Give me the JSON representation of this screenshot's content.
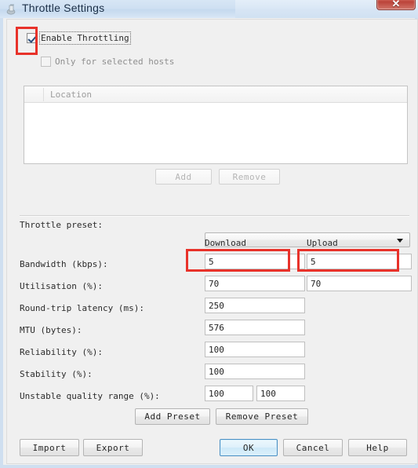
{
  "window": {
    "title": "Throttle Settings",
    "icon": "app-icon",
    "close_label": "✕"
  },
  "options": {
    "enable_throttling": {
      "label": "Enable Throttling",
      "checked": true,
      "focused": true
    },
    "only_selected_hosts": {
      "label": "Only for selected hosts",
      "checked": false,
      "disabled": true
    }
  },
  "hosts_list": {
    "columns": [
      "Location"
    ],
    "rows": [],
    "add_button": "Add",
    "remove_button": "Remove"
  },
  "preset": {
    "label": "Throttle preset:",
    "value": "",
    "placeholder": ""
  },
  "column_headers": {
    "download": "Download",
    "upload": "Upload"
  },
  "fields": [
    {
      "label": "Bandwidth (kbps):",
      "download": "5",
      "upload": "5",
      "type": "pair",
      "highlighted": true
    },
    {
      "label": "Utilisation (%):",
      "download": "70",
      "upload": "70",
      "type": "pair",
      "highlighted": false
    },
    {
      "label": "Round-trip latency (ms):",
      "download": "250",
      "upload": "",
      "type": "single",
      "highlighted": false
    },
    {
      "label": "MTU (bytes):",
      "download": "576",
      "upload": "",
      "type": "single",
      "highlighted": false
    },
    {
      "label": "Reliability (%):",
      "download": "100",
      "upload": "",
      "type": "single",
      "highlighted": false
    },
    {
      "label": "Stability (%):",
      "download": "100",
      "upload": "",
      "type": "single",
      "highlighted": false
    },
    {
      "label": "Unstable quality range (%):",
      "download": "100",
      "upload": "100",
      "type": "narrow-pair",
      "highlighted": false
    }
  ],
  "preset_buttons": {
    "add": "Add Preset",
    "remove": "Remove Preset"
  },
  "footer_buttons": {
    "import": "Import",
    "export": "Export",
    "ok": "OK",
    "cancel": "Cancel",
    "help": "Help"
  },
  "annotations": {
    "color": "#e8322a",
    "boxes": [
      "enable-throttling-checkbox",
      "bandwidth-download-field",
      "bandwidth-upload-field"
    ]
  }
}
